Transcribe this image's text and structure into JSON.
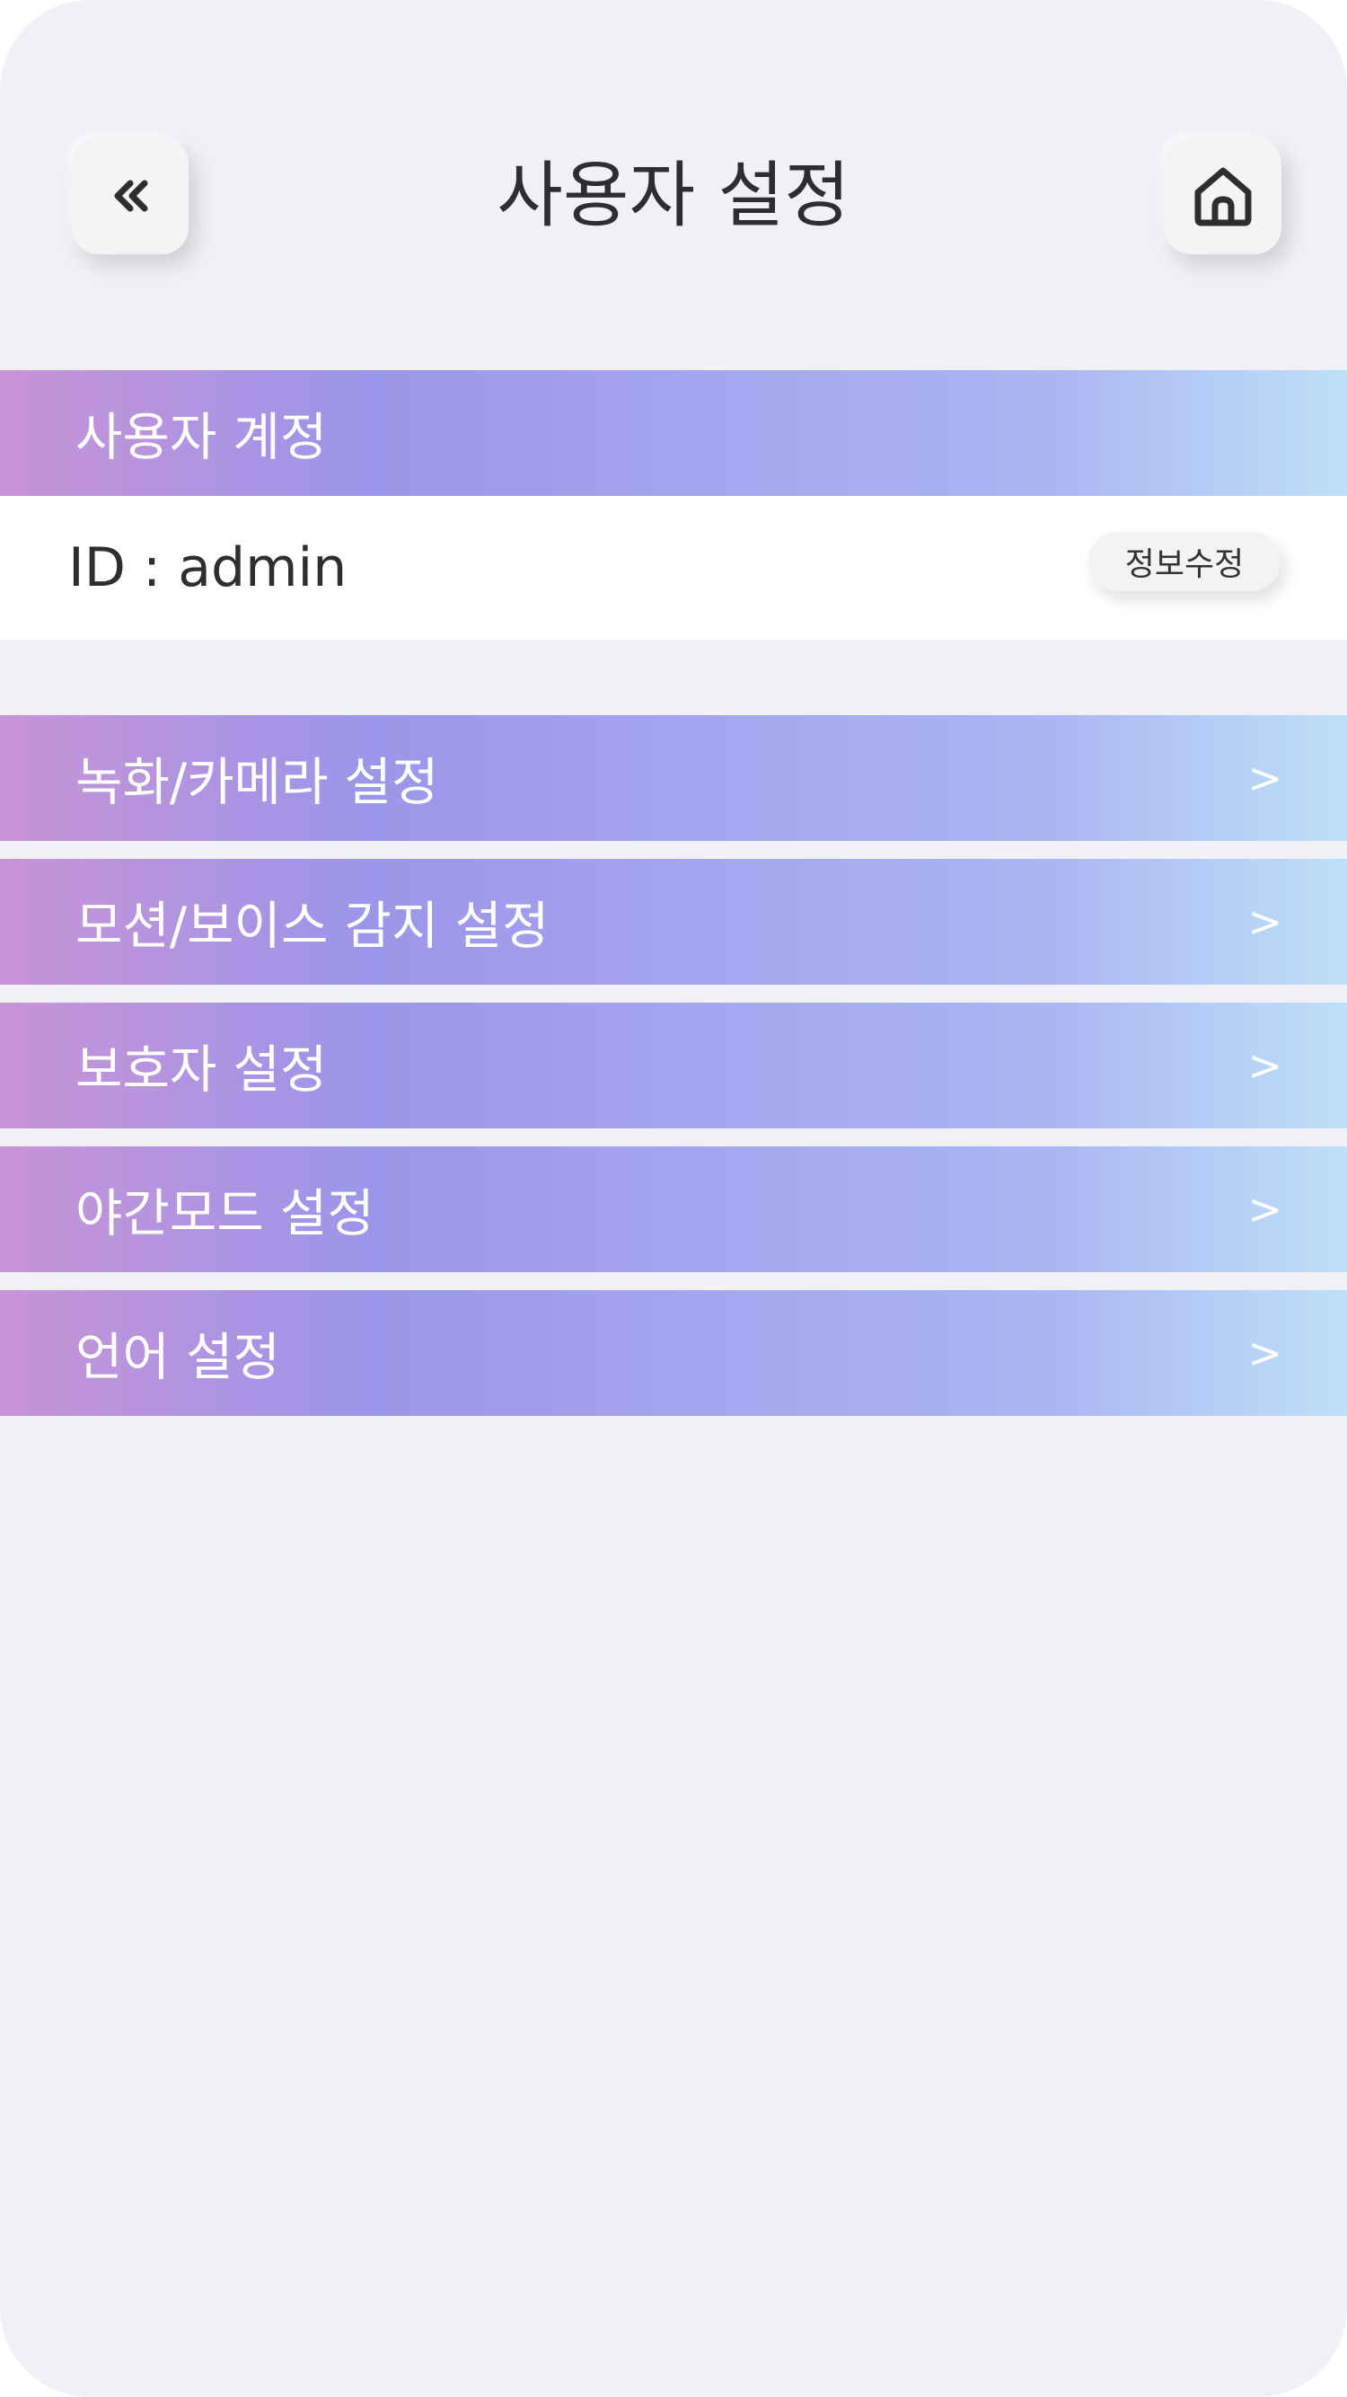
{
  "header": {
    "title": "사용자 설정",
    "back_icon": "double-chevron-left-icon",
    "home_icon": "home-icon"
  },
  "account": {
    "section_label": "사용자 계정",
    "id_text": "ID : admin",
    "edit_label": "정보수정"
  },
  "menu": {
    "chevron": ">",
    "items": [
      {
        "label": "녹화/카메라 설정"
      },
      {
        "label": "모션/보이스 감지 설정"
      },
      {
        "label": "보호자 설정"
      },
      {
        "label": "야간모드 설정"
      },
      {
        "label": "언어 설정"
      }
    ]
  },
  "colors": {
    "background": "#f1f0f6",
    "gradient": [
      "#c893d5",
      "#9c95ea",
      "#a4a8ee",
      "#abb6f2",
      "#bee0f8"
    ],
    "text_dark": "#2e2e31"
  }
}
